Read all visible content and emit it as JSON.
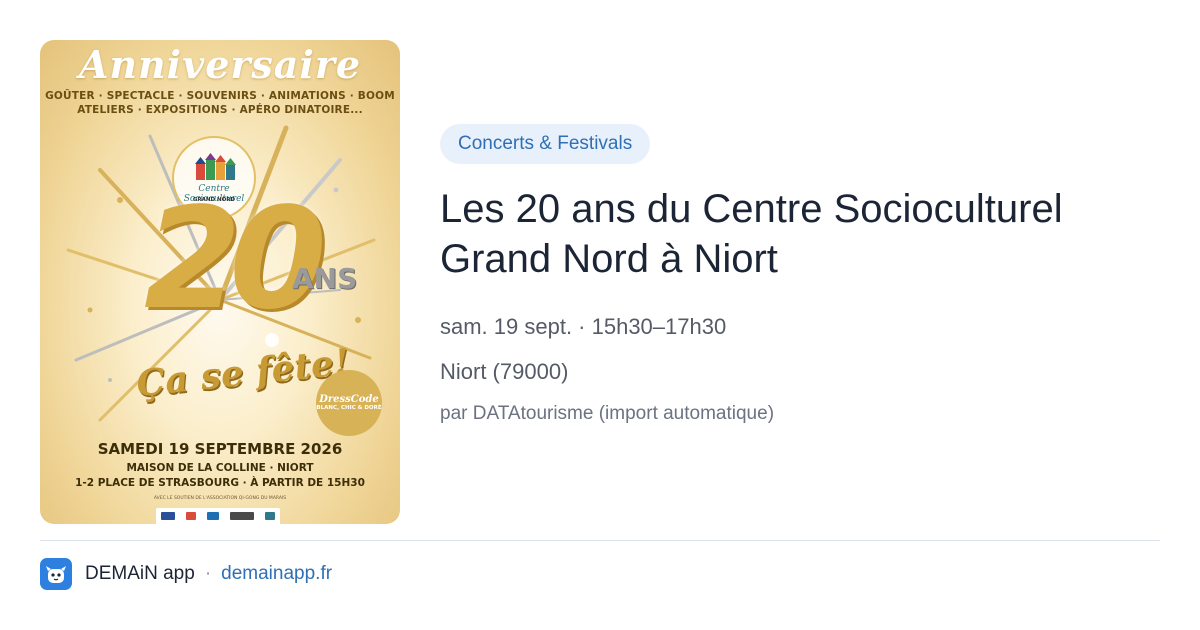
{
  "poster": {
    "title": "Anniversaire",
    "activities_line1": "GOÛTER · SPECTACLE · SOUVENIRS · ANIMATIONS · BOOM",
    "activities_line2": "ATELIERS · EXPOSITIONS · APÉRO DINATOIRE...",
    "logo_name": "Centre Socioculturel",
    "logo_sub": "GRAND NORD",
    "number": "20",
    "ans": "ANS",
    "slogan": "Ça se fête!",
    "dresscode_title": "DressCode",
    "dresscode_text": "BLANC, CHIC & DORÉ",
    "date": "SAMEDI 19 SEPTEMBRE 2026",
    "place_line1": "MAISON DE LA COLLINE · NIORT",
    "place_line2": "1-2 PLACE DE STRASBOURG · À PARTIR DE 15H30",
    "support_text": "AVEC LE SOUTIEN DE L'ASSOCIATION QI-GONG DU MARAIS",
    "colors": {
      "gold": "#d9ad45",
      "gold_dark": "#b8892a",
      "bg": "#fbeecb"
    }
  },
  "event": {
    "category": "Concerts & Festivals",
    "title": "Les 20 ans du Centre Socioculturel Grand Nord à Niort",
    "datetime": "sam. 19 sept. · 15h30–17h30",
    "location": "Niort (79000)",
    "source": "par DATAtourisme (import automatique)"
  },
  "footer": {
    "app_icon": "demain-app-icon",
    "app_name": "DEMAiN app",
    "separator": "·",
    "link": "demainapp.fr"
  },
  "colors": {
    "accent": "#2f6fb5",
    "category_bg": "#e8f1fb",
    "title": "#1c2536",
    "meta": "#555b66",
    "app_icon_bg": "#2d7fe0"
  }
}
